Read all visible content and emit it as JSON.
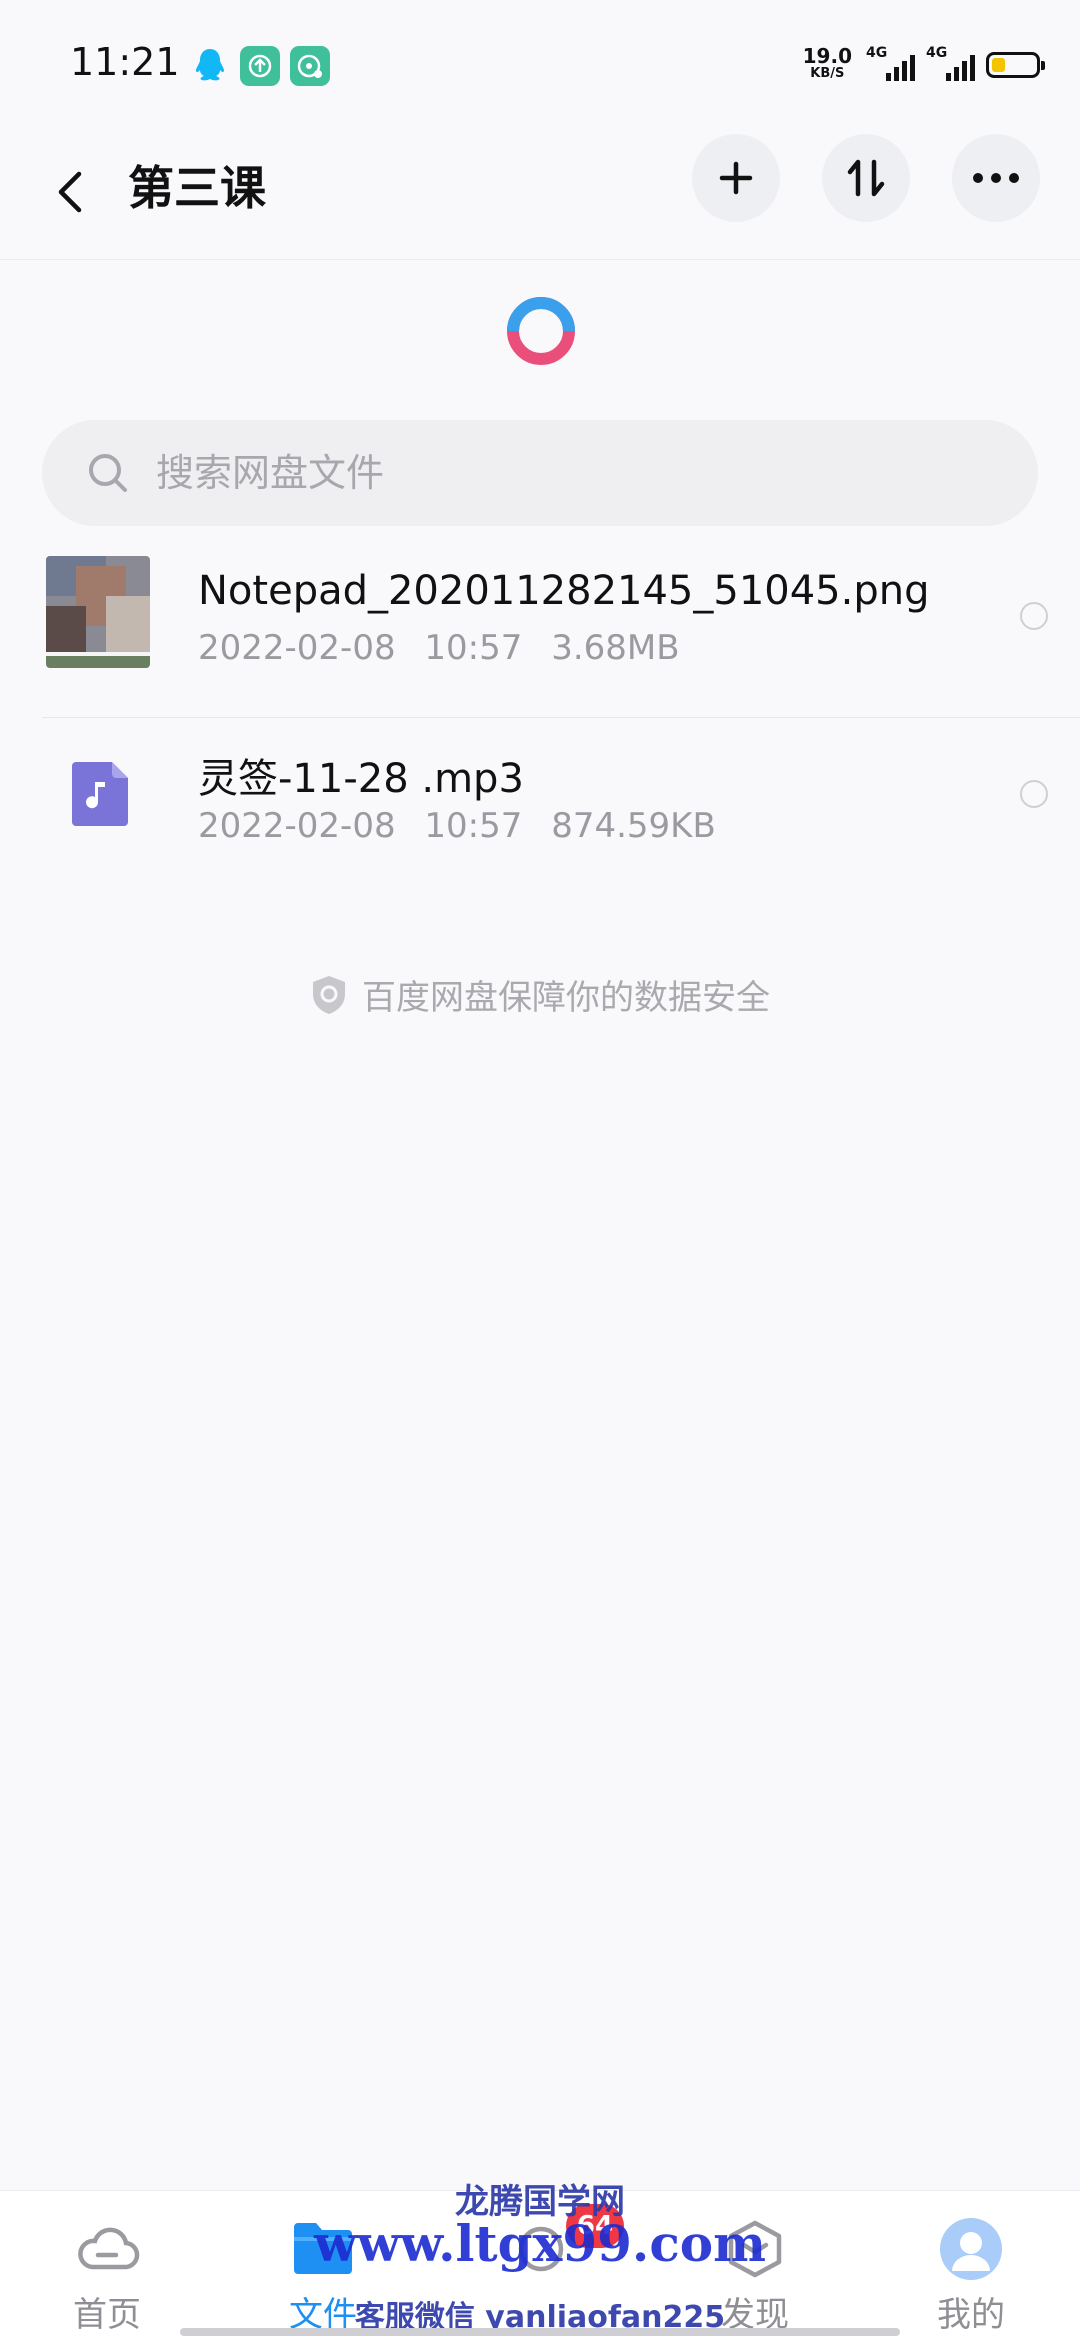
{
  "status_bar": {
    "time": "11:21",
    "net_speed_value": "19.0",
    "net_speed_unit": "KB/S",
    "signal_1_label": "4G",
    "signal_2_label": "4G",
    "battery_level": 0.3,
    "colors": {
      "qq": "#12b7f5",
      "app_green": "#3fbf9a",
      "battery_fill": "#f5c400"
    }
  },
  "header": {
    "back_icon": "chevron-left-icon",
    "title": "第三课",
    "add_icon": "plus-icon",
    "sort_icon": "sort-arrows-icon",
    "more_icon": "more-dots-icon"
  },
  "search": {
    "placeholder": "搜索网盘文件",
    "value": ""
  },
  "files": [
    {
      "name": "Notepad_202011282145_51045.png",
      "date": "2022-02-08",
      "time": "10:57",
      "size": "3.68MB",
      "icon": "image-thumbnail"
    },
    {
      "name": "灵签-11-28 .mp3",
      "date": "2022-02-08",
      "time": "10:57",
      "size": "874.59KB",
      "icon": "music-file-icon"
    }
  ],
  "security_notice": "百度网盘保障你的数据安全",
  "bottom_nav": {
    "items": [
      {
        "label": "首页",
        "icon": "cloud-icon"
      },
      {
        "label": "文件",
        "icon": "folder-icon",
        "active": true
      },
      {
        "label": "",
        "icon": "share-icon"
      },
      {
        "label": "发现",
        "icon": "discover-icon"
      },
      {
        "label": "我的",
        "icon": "avatar-icon"
      }
    ],
    "badge_count": "64",
    "active_color": "#1e8ff3"
  },
  "watermark": {
    "line1": "龙腾国学网",
    "line2": "www.ltgx99.com",
    "line3": "客服微信 yanliaofan225"
  }
}
